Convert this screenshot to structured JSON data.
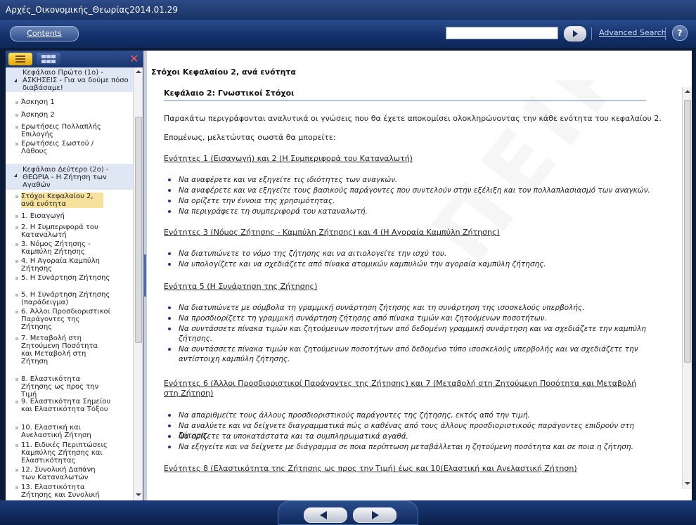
{
  "window": {
    "title": "Αρχές_Οικονομικής_Θεωρίας2014.01.29"
  },
  "toolbar": {
    "contents_label": "Contents",
    "search_value": "",
    "advanced_search_label": "Advanced Search",
    "help_label": "?"
  },
  "sidebar": {
    "close_label": "✕",
    "items": [
      {
        "label": "Κεφάλαιο Πρώτο (1ο) - ΑΣΚΗΣΕΙΣ - Για να δούμε πόσο διαβάσαμε!"
      },
      {
        "label": "Άσκηση 1"
      },
      {
        "label": "Άσκηση 2"
      },
      {
        "label": "Ερωτήσεις Πολλαπλής Επιλογής"
      },
      {
        "label": "Ερωτήσεις Σωστού / Λάθους"
      },
      {
        "label": "Κεφάλαιο Δεύτερο (2ο) - ΘΕΩΡΙΑ - Η Ζήτηση των Αγαθών"
      },
      {
        "label": "Στόχοι Κεφαλαίου 2, ανά ενότητα"
      },
      {
        "label": "1. Εισαγωγή"
      },
      {
        "label": "2. Η Συμπεριφορά του Καταναλωτή"
      },
      {
        "label": "3. Νόμος Ζήτησης - Καμπύλη Ζήτησης"
      },
      {
        "label": "4. Η Αγοραία Καμπύλη Ζήτησης"
      },
      {
        "label": "5. Η Συνάρτηση Ζήτησης"
      },
      {
        "label": "5. Η Συνάρτηση Ζήτησης (παράδειγμα)"
      },
      {
        "label": "6. Άλλοι Προσδιοριστικοί Παράγοντες της Ζήτησης"
      },
      {
        "label": "7. Μεταβολή στη Ζητούμενη Ποσότητα και Μεταβολή στη Ζήτηση"
      },
      {
        "label": "8. Ελαστικότητα Ζήτησης ως προς την Τιμή"
      },
      {
        "label": "9. Ελαστικότητα Σημείου και Ελαστικότητα Τόξου"
      },
      {
        "label": "10. Ελαστική και Ανελαστική Ζήτηση"
      },
      {
        "label": "11. Ειδικές Περιπτώσεις Καμπύλης Ζήτησης και Ελαστικότητας"
      },
      {
        "label": "12. Συνολική Δαπάνη των Καταναλωτών"
      },
      {
        "label": "13. Ελαστικότητα Ζήτησης και Συνολική"
      }
    ]
  },
  "content": {
    "page_title": "Στόχοι Κεφαλαίου 2, ανά ενότητα",
    "heading": "Κεφάλαιο 2: Γνωστικοί Στόχοι",
    "intro": "Παρακάτω περιγράφονται αναλυτικά οι γνώσεις που θα έχετε αποκομίσει ολοκληρώνοντας την κάθε ενότητα του κεφαλαίου 2.",
    "intro2": "Επομένως, μελετώντας σωστά θα μπορείτε:",
    "sections": [
      {
        "title": "Ενότητες 1 (Εισαγωγή) και 2 (Η Συμπεριφορά του Καταναλωτή)",
        "bullets": [
          "Να αναφέρετε και να εξηγείτε τις ιδιότητες των αναγκών.",
          "Να αναφέρετε και να εξηγείτε τους βασικούς παράγοντες που συντελούν στην εξέλιξη και τον πολλαπλασιασμό των αναγκών.",
          "Να ορίζετε την έννοια της χρησιμότητας.",
          "Να περιγράφετε τη συμπεριφορά του καταναλωτή."
        ]
      },
      {
        "title": "Ενότητες 3 (Νόμος Ζήτησης - Καμπύλη Ζήτησης) και 4 (Η Αγοραία Καμπύλη Ζήτησης)",
        "bullets": [
          "Να διατυπώνετε το νόμο της ζήτησης και να αιτιολογείτε την ισχύ του.",
          "Να υπολογίζετε και να σχεδιάζετε από πίνακα ατομικών καμπυλών την αγοραία καμπύλη ζήτησης."
        ]
      },
      {
        "title": "Ενότητα 5 (Η Συνάρτηση της Ζήτησης)",
        "bullets": [
          "Να διατυπώνετε με σύμβολα τη γραμμική συνάρτηση ζήτησης και τη συνάρτηση της ισοσκελούς υπερβολής.",
          "Να προσδιορίζετε τη γραμμική συνάρτηση ζήτησης από πίνακα τιμών και ζητούμενων ποσοτήτων.",
          "Να συντάσσετε πίνακα τιμών και ζητούμενων ποσοτήτων από δεδομένη γραμμική συνάρτηση και να σχεδιάζετε την καμπύλη ζήτησης.",
          "Να συντάσσετε πίνακα τιμών και ζητούμενων ποσοτήτων από δεδομένο τύπο ισοσκελούς υπερβολής και να σχεδιάζετε την αντίστοιχη καμπύλη ζήτησης."
        ]
      },
      {
        "title": "Ενότητες 6 (Άλλοι Προσδιοριστικοί Παράγοντες της Ζήτησης) και 7 (Μεταβολή στη Ζητούμενη Ποσότητα και Μεταβολή στη Ζήτηση)",
        "bullets": [
          "Να απαριθμείτε τους άλλους προσδιοριστικούς παράγοντες της ζήτησης, εκτός από την τιμή.",
          "Να αναλύετε και να δείχνετε διαγραμματικά πώς ο καθένας από τους άλλους προσδιοριστικούς παράγοντες επιδρούν στη ζήτηση.",
          "Να ορίζετε τα υποκατάστατα και τα συμπληρωματικά αγαθά.",
          "Να εξηγείτε και να δείχνετε με διάγραμμα σε ποια περίπτωση μεταβάλλεται η ζητούμενη ποσότητα και σε ποια η ζήτηση."
        ]
      },
      {
        "title": "Ενότητες 8 (Ελαστικότητα της Ζήτησης ως προς την Τιμή) έως και 10(Ελαστική και Ανελαστική Ζήτηση)",
        "bullets": []
      }
    ],
    "watermark": "ΠΕΙΡΑΙΩΣ"
  }
}
